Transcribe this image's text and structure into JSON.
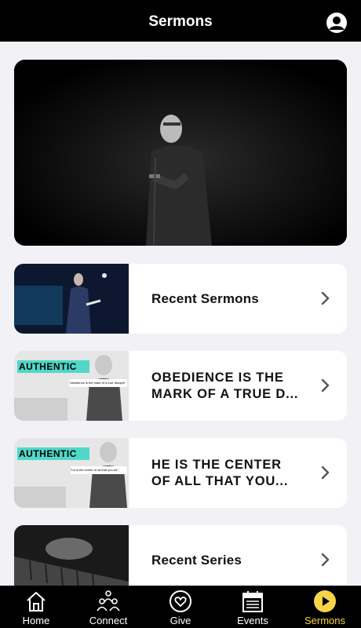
{
  "header": {
    "title": "Sermons",
    "profile_icon": "user-circle-icon"
  },
  "hero": {
    "image": "preacher-on-stage-photo"
  },
  "cards": [
    {
      "label": "Recent Sermons",
      "thumb": "preacher-stage-thumbnail"
    },
    {
      "label": "OBEDIENCE IS THE\nMARK OF A TRUE D...",
      "thumb": "authentic-series-thumbnail",
      "thumb_title": "AUTHENTIC",
      "thumb_quote": "\"obedience is the mark of a true disciple\""
    },
    {
      "label": "HE IS THE CENTER\nOF ALL THAT YOU...",
      "thumb": "authentic-series-thumbnail",
      "thumb_title": "AUTHENTIC",
      "thumb_quote": "\"he is the center of all that you do\""
    },
    {
      "label": "Recent Series",
      "thumb": "piano-keys-thumbnail"
    }
  ],
  "tabs": [
    {
      "label": "Home",
      "icon": "home-icon"
    },
    {
      "label": "Connect",
      "icon": "people-icon"
    },
    {
      "label": "Give",
      "icon": "heart-icon"
    },
    {
      "label": "Events",
      "icon": "calendar-icon"
    },
    {
      "label": "Sermons",
      "icon": "play-icon",
      "active": true
    }
  ],
  "colors": {
    "accent": "#f5d547",
    "teal": "#4fd8c8"
  }
}
